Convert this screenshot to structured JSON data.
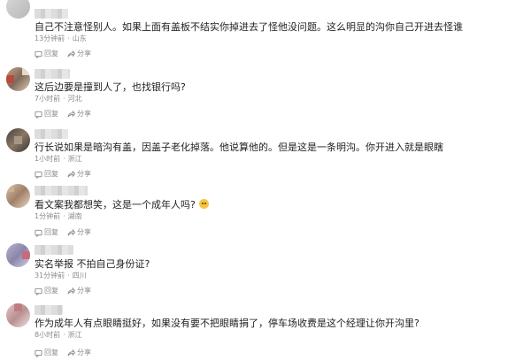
{
  "labels": {
    "reply": "回复",
    "share": "分享"
  },
  "comments": [
    {
      "text": "自己不注意怪别人。如果上面有盖板不结实你掉进去了怪他没问题。这么明显的沟你自己开进去怪谁",
      "time": "13分钟前",
      "location": "山东"
    },
    {
      "text": "这后边要是撞到人了，也找银行吗?",
      "time": "7小时前",
      "location": "河北"
    },
    {
      "text": "行长说如果是暗沟有盖，因盖子老化掉落。他说算他的。但是这是一条明沟。你开进入就是眼瞎",
      "time": "1小时前",
      "location": "浙江"
    },
    {
      "text": "看文案我都想笑，这是一个成年人吗?",
      "time": "1分钟前",
      "location": "湖南"
    },
    {
      "text": "实名举报 不拍自己身份证?",
      "time": "31分钟前",
      "location": "四川"
    },
    {
      "text": "作为成年人有点眼睛挺好，如果没有要不把眼睛捐了，停车场收费是这个经理让你开沟里?",
      "time": "8小时前",
      "location": "浙江"
    }
  ]
}
